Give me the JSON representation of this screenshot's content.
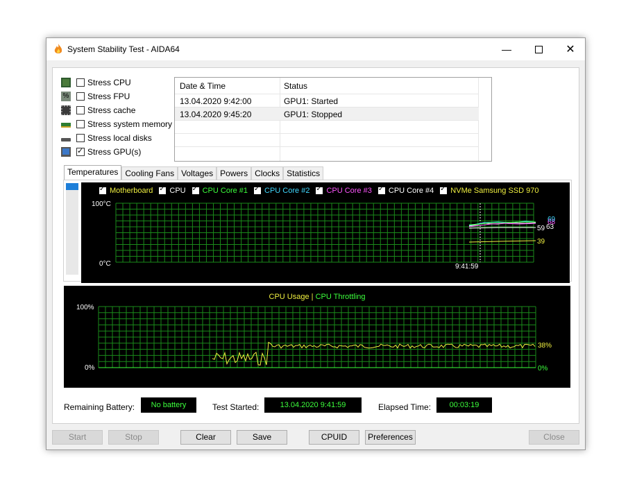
{
  "window": {
    "title": "System Stability Test - AIDA64"
  },
  "options": [
    {
      "label": "Stress CPU",
      "checked": false,
      "icon": "cpu-chip-icon"
    },
    {
      "label": "Stress FPU",
      "checked": false,
      "icon": "percent-chip-icon"
    },
    {
      "label": "Stress cache",
      "checked": false,
      "icon": "cache-chip-icon"
    },
    {
      "label": "Stress system memory",
      "checked": false,
      "icon": "memory-module-icon"
    },
    {
      "label": "Stress local disks",
      "checked": false,
      "icon": "disk-drive-icon"
    },
    {
      "label": "Stress GPU(s)",
      "checked": true,
      "icon": "monitor-icon"
    }
  ],
  "log": {
    "headers": [
      "Date & Time",
      "Status"
    ],
    "rows": [
      {
        "time": "13.04.2020 9:42:00",
        "status": "GPU1: Started"
      },
      {
        "time": "13.04.2020 9:45:20",
        "status": "GPU1: Stopped"
      }
    ]
  },
  "tabs": [
    "Temperatures",
    "Cooling Fans",
    "Voltages",
    "Powers",
    "Clocks",
    "Statistics"
  ],
  "temp_graph": {
    "legend": [
      {
        "label": "Motherboard",
        "color": "#f0f040"
      },
      {
        "label": "CPU",
        "color": "#ffffff"
      },
      {
        "label": "CPU Core #1",
        "color": "#3cff3c"
      },
      {
        "label": "CPU Core #2",
        "color": "#40d8ff"
      },
      {
        "label": "CPU Core #3",
        "color": "#ff55ff"
      },
      {
        "label": "CPU Core #4",
        "color": "#ffffff"
      },
      {
        "label": "NVMe Samsung SSD 970",
        "color": "#f0f040"
      }
    ],
    "y_top": "100°C",
    "y_bottom": "0°C",
    "time_label": "9:41:59",
    "values": {
      "v59": "59",
      "v63": "63",
      "v69": "69",
      "v68": "68",
      "v39": "39"
    }
  },
  "usage_graph": {
    "legend_usage": "CPU Usage",
    "separator": "|",
    "legend_throttling": "CPU Throttling",
    "y_top": "100%",
    "y_bottom": "0%",
    "right_usage": "38%",
    "right_throttle": "0%",
    "usage_color": "#f0f040",
    "throttle_color": "#3cff3c"
  },
  "status": {
    "battery_label": "Remaining Battery:",
    "battery_value": "No battery",
    "started_label": "Test Started:",
    "started_value": "13.04.2020 9:41:59",
    "elapsed_label": "Elapsed Time:",
    "elapsed_value": "00:03:19"
  },
  "buttons": {
    "start": "Start",
    "stop": "Stop",
    "clear": "Clear",
    "save": "Save",
    "cpuid": "CPUID",
    "preferences": "Preferences",
    "close": "Close"
  }
}
